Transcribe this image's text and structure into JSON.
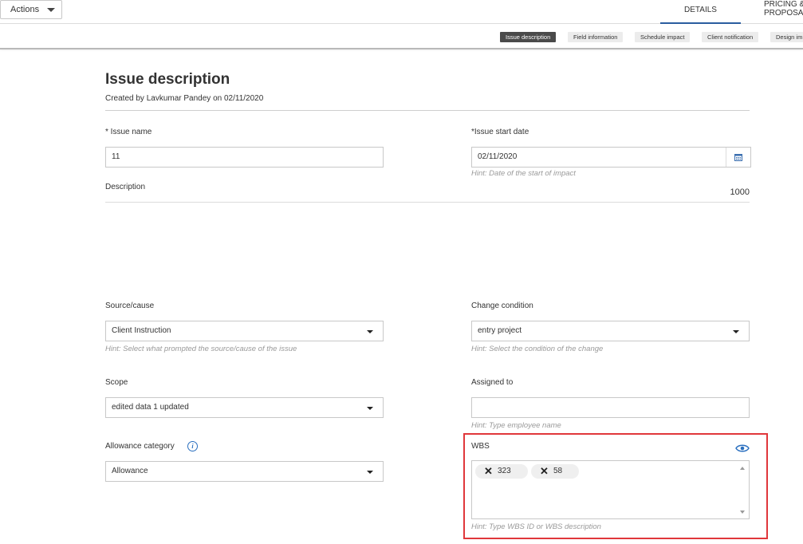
{
  "toolbar": {
    "actions_label": "Actions"
  },
  "tabs": {
    "details": "DETAILS",
    "pricing": "PRICING & PROPOSAL"
  },
  "section_nav": [
    "Issue description",
    "Field information",
    "Schedule impact",
    "Client notification",
    "Design im"
  ],
  "header": {
    "title": "Issue description",
    "subtitle": "Created by Lavkumar Pandey on 02/11/2020"
  },
  "form": {
    "issue_name": {
      "label": "* Issue name",
      "value": "11"
    },
    "issue_start_date": {
      "label": "*Issue start date",
      "value": "02/11/2020",
      "hint": "Hint: Date of the start of impact"
    },
    "description": {
      "label": "Description",
      "counter": "1000"
    },
    "source_cause": {
      "label": "Source/cause",
      "value": "Client Instruction",
      "hint": "Hint: Select what prompted the source/cause of the issue"
    },
    "change_condition": {
      "label": "Change condition",
      "value": "entry project",
      "hint": "Hint: Select the condition of the change"
    },
    "scope": {
      "label": "Scope",
      "value": "edited data 1 updated"
    },
    "assigned_to": {
      "label": "Assigned to",
      "value": "",
      "hint": "Hint: Type employee name"
    },
    "allowance_category": {
      "label": "Allowance category",
      "value": "Allowance"
    },
    "wbs": {
      "label": "WBS",
      "chips": [
        "323",
        "58"
      ],
      "hint": "Hint: Type WBS ID or WBS description"
    }
  },
  "colors": {
    "accent": "#2a5d9f",
    "highlight": "#e0373b",
    "active_pill": "#4a4a4a"
  },
  "icons": {
    "calendar": "calendar-icon",
    "info": "info-icon",
    "eye": "eye-icon",
    "remove": "close-icon",
    "dropdown": "chevron-down-icon"
  }
}
